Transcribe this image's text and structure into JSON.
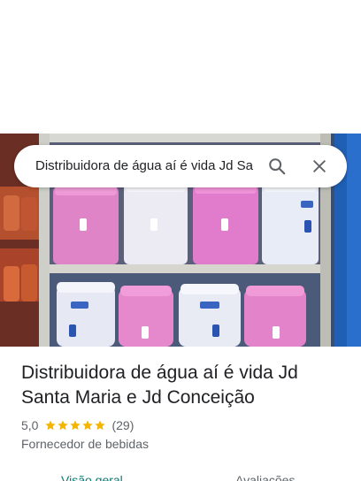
{
  "search": {
    "query": "Distribuidora de água aí é vida Jd Santa Maria e Jd Conceição"
  },
  "icons": {
    "search": "search-icon",
    "close": "close-icon",
    "star": "star-icon"
  },
  "place": {
    "name": "Distribuidora de água aí é vida Jd Santa Maria e Jd Conceição",
    "rating": "5,0",
    "rating_value": 5.0,
    "stars_filled": 5,
    "reviews": "(29)",
    "category": "Fornecedor de bebidas"
  },
  "tabs": [
    {
      "label": "Visão geral",
      "active": true
    },
    {
      "label": "Avaliações",
      "active": false
    }
  ],
  "colors": {
    "star": "#f4b400",
    "active_tab": "#0b7b74",
    "text_primary": "#202124",
    "text_secondary": "#5f6368"
  }
}
